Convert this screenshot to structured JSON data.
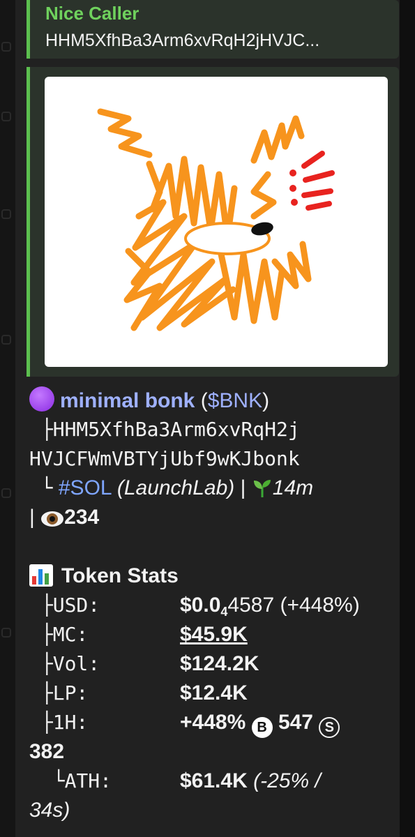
{
  "reply": {
    "name": "Nice Caller",
    "text": "HHM5XfhBa3Arm6xvRqH2jHVJC..."
  },
  "token": {
    "name": "minimal bonk",
    "paren_open": "(",
    "symbol": "$BNK",
    "paren_close": ")",
    "tree_top": "├",
    "address_line1": "HHM5XfhBa3Arm6xvRqH2j",
    "address_line2": "HVJCFWmVBTYjUbf9wKJbonk",
    "tree_end": "└",
    "chain": "#SOL",
    "platform": "(LaunchLab)",
    "sep": "|",
    "age": "14m",
    "views": "234"
  },
  "stats": {
    "heading": "Token Stats",
    "usd_label": "USD:",
    "usd_value_prefix": "$0.0",
    "usd_value_sub": "4",
    "usd_value_rest": "4587 (+448%)",
    "mc_label": "MC:",
    "mc_value": "$45.9K",
    "vol_label": "Vol:",
    "vol_value": "$124.2K",
    "lp_label": "LP:",
    "lp_value": "$12.4K",
    "h1_label": "1H:",
    "h1_change": "+448%",
    "buy_badge": "B",
    "buys": "547",
    "sell_badge": "S",
    "sells": "382",
    "ath_label": "ATH:",
    "ath_value": "$61.4K",
    "ath_detail_line1": "(-25% /",
    "ath_detail_line2": "34s)"
  },
  "icons": {
    "token_dot": "purple-circle-icon",
    "sprout": "seedling-icon",
    "eye": "eye-icon",
    "chart": "bar-chart-icon",
    "buy": "circled-b-icon",
    "sell": "circled-s-icon"
  },
  "colors": {
    "accent_green": "#5cbf4f",
    "link_blue": "#7fa6ff",
    "bubble_bg": "#212121"
  }
}
